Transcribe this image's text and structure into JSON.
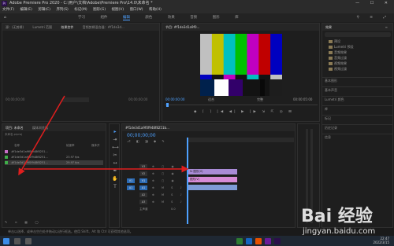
{
  "window": {
    "title": "Adobe Premiere Pro 2020 - C:\\用户\\文档\\Adobe\\Premiere Pro\\14.0\\未命名 *",
    "logo": "Pr",
    "controls": "— ☐ ✕"
  },
  "menu": [
    "文件(F)",
    "编辑(E)",
    "剪辑(C)",
    "序列(S)",
    "标记(M)",
    "图形(G)",
    "视图(V)",
    "窗口(W)",
    "帮助(H)"
  ],
  "workspace": {
    "tabs": [
      "学习",
      "组件",
      "编辑",
      "颜色",
      "效果",
      "音频",
      "图形",
      "库"
    ],
    "active": 2
  },
  "source_panel": {
    "tabs": [
      "源：(无剪辑)",
      "Lumetri 范围",
      "效果控件",
      "音频剪辑混合器：#f1de3d..."
    ],
    "timecode_left": "00;00;00;00",
    "timecode_right": "00;00;00;00"
  },
  "program_panel": {
    "tab": "节目: #f1de3d1a9f0...",
    "timecode_left": "00:00:00:00",
    "fit": "适合",
    "quality": "完整",
    "timecode_right": "00:00:05:00",
    "colors": [
      "#c0c0c0",
      "#c0c000",
      "#00c0c0",
      "#00c000",
      "#c000c0",
      "#c00000",
      "#0000c0",
      "#131313"
    ]
  },
  "effects_panel": {
    "tabs": [
      "效果",
      "≡"
    ],
    "items": [
      "预设",
      "Lumetri 预设",
      "音频效果",
      "音频过渡",
      "视频效果",
      "视频过渡"
    ],
    "sections": [
      "基本图形",
      "基本声音",
      "Lumetri 颜色",
      "库",
      "标记",
      "历史记录",
      "信息"
    ]
  },
  "project_panel": {
    "tabs": [
      "项目: 未命名",
      "媒体浏览器"
    ],
    "search_placeholder": "未命名.prproj",
    "col_name": "名称",
    "col_fps": "帧速率",
    "col_media": "媒体开",
    "rows": [
      {
        "name": "#f1de3d1a9f0f948f8251...",
        "fps": "",
        "color": "#c86fc8"
      },
      {
        "name": "#f1de3d1a9f0f948f8251...",
        "fps": "23.97 fps",
        "color": "#3fae49"
      },
      {
        "name": "#f1de3d1a9f0f948f8251...",
        "fps": "29.97 fps",
        "color": "#3fae49"
      }
    ]
  },
  "timeline": {
    "tab": "#f1de3d1a9f0f948f8251b...",
    "timecode": "00;00;00;00",
    "tracks": [
      "V3",
      "V2",
      "V1",
      "A1",
      "A2",
      "A3"
    ],
    "master": "主声道",
    "master_value": "0.0",
    "clips": [
      {
        "label": "fx 图形(V)",
        "color": "#a98bd6"
      },
      {
        "label": "图形(V)",
        "color": "#d78bd6"
      },
      {
        "label": "",
        "color": "#7f9bd6"
      }
    ]
  },
  "status_bar": {
    "text": "单击以选择，或单击空白处并拖动以进行框选。使用 Shift、Alt 和 Ctrl 可获得其他选项。"
  },
  "taskbar": {
    "time": "22:47",
    "date": "2022/3/15"
  },
  "watermark": {
    "brand": "Bai 经验",
    "url": "jingyan.baidu.com"
  }
}
